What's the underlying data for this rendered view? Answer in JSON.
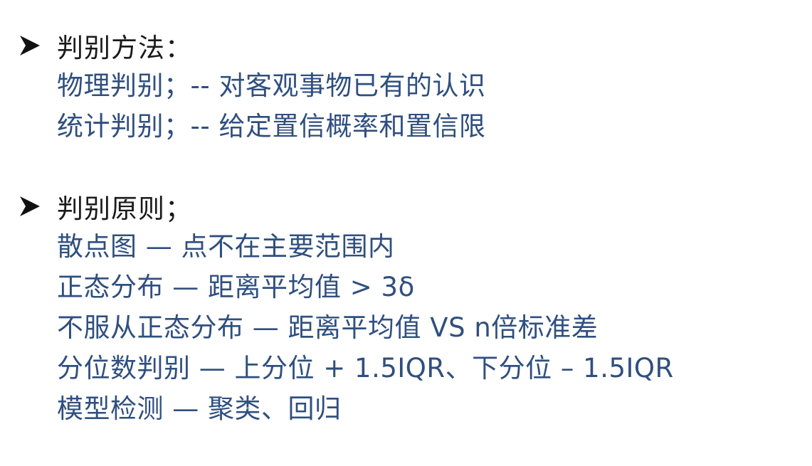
{
  "section1": {
    "bullet_icon": "arrowhead-bullet-icon",
    "heading": "判别方法：",
    "lines": [
      "物理判别；-- 对客观事物已有的认识",
      "统计判别；-- 给定置信概率和置信限"
    ]
  },
  "section2": {
    "bullet_icon": "arrowhead-bullet-icon",
    "heading": "判别原则；",
    "lines": [
      "散点图 — 点不在主要范围内",
      "正态分布 — 距离平均值 > 3δ",
      "不服从正态分布 — 距离平均值 VS n倍标准差",
      "分位数判别 — 上分位 + 1.5IQR、下分位 – 1.5IQR",
      "模型检测 — 聚类、回归"
    ]
  },
  "colors": {
    "heading": "#1a1a1a",
    "body_text": "#2f4f7f",
    "background": "#ffffff"
  }
}
